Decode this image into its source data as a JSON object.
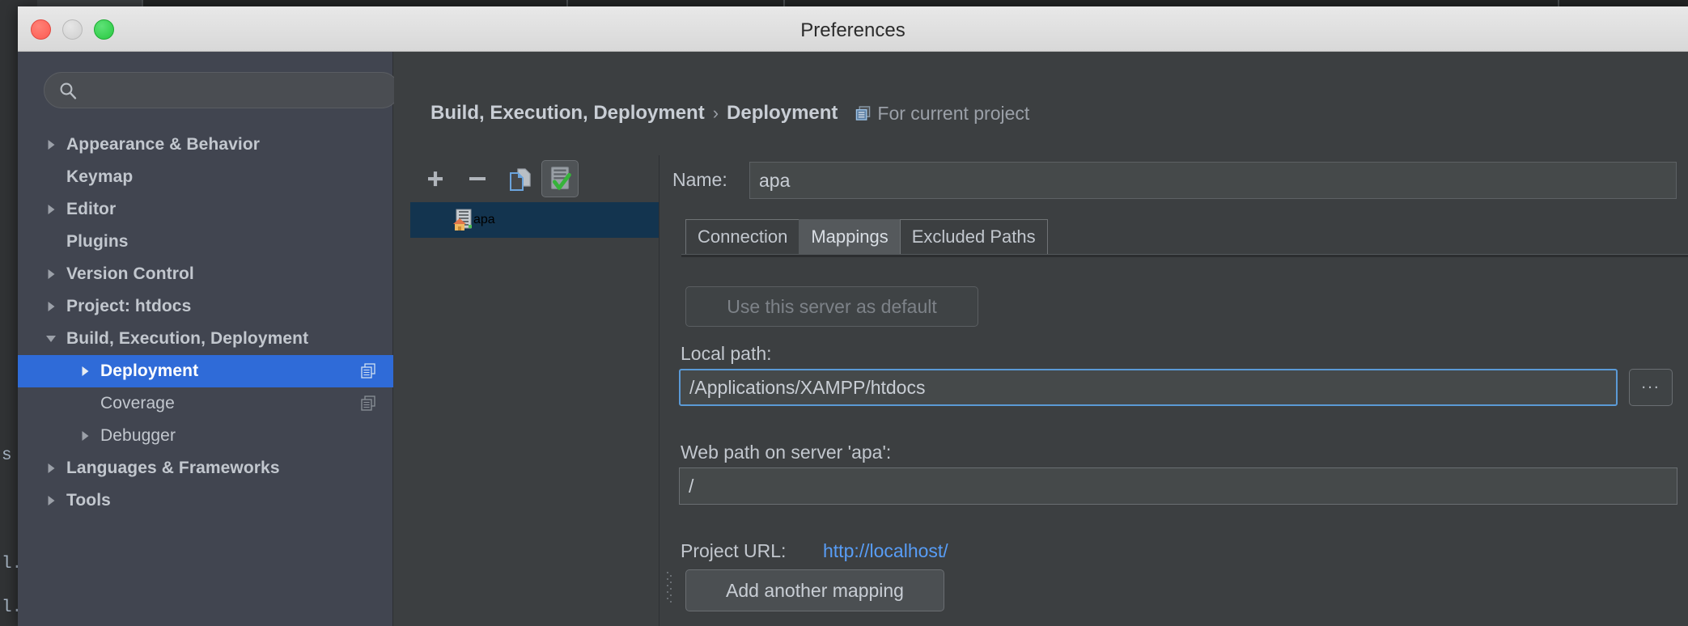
{
  "backdrop": {
    "code_lines": [
      "s",
      "l.",
      "l."
    ]
  },
  "window": {
    "title": "Preferences",
    "traffic_lights": {
      "close": "close-button",
      "minimize": "minimize-button",
      "maximize": "maximize-button"
    }
  },
  "search": {
    "value": "",
    "placeholder": "",
    "icon": "search-icon"
  },
  "sidebar": {
    "items": [
      {
        "label": "Appearance & Behavior",
        "arrow": "collapsed",
        "indent": 0,
        "bold": true,
        "selected": false,
        "badge": false
      },
      {
        "label": "Keymap",
        "arrow": "none",
        "indent": 0,
        "bold": true,
        "selected": false,
        "badge": false
      },
      {
        "label": "Editor",
        "arrow": "collapsed",
        "indent": 0,
        "bold": true,
        "selected": false,
        "badge": false
      },
      {
        "label": "Plugins",
        "arrow": "none",
        "indent": 0,
        "bold": true,
        "selected": false,
        "badge": false
      },
      {
        "label": "Version Control",
        "arrow": "collapsed",
        "indent": 0,
        "bold": true,
        "selected": false,
        "badge": false
      },
      {
        "label": "Project: htdocs",
        "arrow": "collapsed",
        "indent": 0,
        "bold": true,
        "selected": false,
        "badge": false
      },
      {
        "label": "Build, Execution, Deployment",
        "arrow": "expanded",
        "indent": 0,
        "bold": true,
        "selected": false,
        "badge": false
      },
      {
        "label": "Deployment",
        "arrow": "collapsed",
        "indent": 1,
        "bold": true,
        "selected": true,
        "badge": true
      },
      {
        "label": "Coverage",
        "arrow": "none",
        "indent": 1,
        "bold": false,
        "selected": false,
        "badge": true
      },
      {
        "label": "Debugger",
        "arrow": "collapsed",
        "indent": 1,
        "bold": false,
        "selected": false,
        "badge": false
      },
      {
        "label": "Languages & Frameworks",
        "arrow": "collapsed",
        "indent": 0,
        "bold": true,
        "selected": false,
        "badge": false
      },
      {
        "label": "Tools",
        "arrow": "collapsed",
        "indent": 0,
        "bold": true,
        "selected": false,
        "badge": false
      }
    ]
  },
  "breadcrumb": {
    "part1": "Build, Execution, Deployment",
    "separator": "›",
    "part2": "Deployment",
    "badge_icon": "module-scope-icon",
    "badge_text": "For current project"
  },
  "server_toolbar": {
    "add_label": "+",
    "remove_label": "−",
    "copy_icon": "copy-server-icon",
    "default_icon": "set-default-server-icon"
  },
  "server_list": {
    "items": [
      {
        "label": "apa",
        "icon": "web-server-icon",
        "selected": true
      }
    ]
  },
  "form": {
    "name_label": "Name:",
    "name_value": "apa",
    "name_placeholder": "",
    "tabs": [
      {
        "label": "Connection",
        "active": false
      },
      {
        "label": "Mappings",
        "active": true
      },
      {
        "label": "Excluded Paths",
        "active": false
      }
    ],
    "use_default_button": "Use this server as default",
    "local_path_label": "Local path:",
    "local_path_value": "/Applications/XAMPP/htdocs",
    "local_path_placeholder": "",
    "browse_button": "...",
    "web_path_label": "Web path on server 'apa':",
    "web_path_value": "/",
    "web_path_placeholder": "",
    "project_url_label": "Project URL:",
    "project_url_value": "http://localhost/",
    "add_mapping_button": "Add another mapping"
  },
  "colors": {
    "window_bg": "#3c3f41",
    "sidebar_bg": "#414550",
    "selection_blue": "#2f6bd8",
    "list_selection": "#13344f",
    "focus_border": "#5b9ad6",
    "link_blue": "#589df6",
    "text_primary": "#c2c7ce",
    "text_dim": "#8b9098",
    "titlebar_top": "#e8e8e8"
  }
}
